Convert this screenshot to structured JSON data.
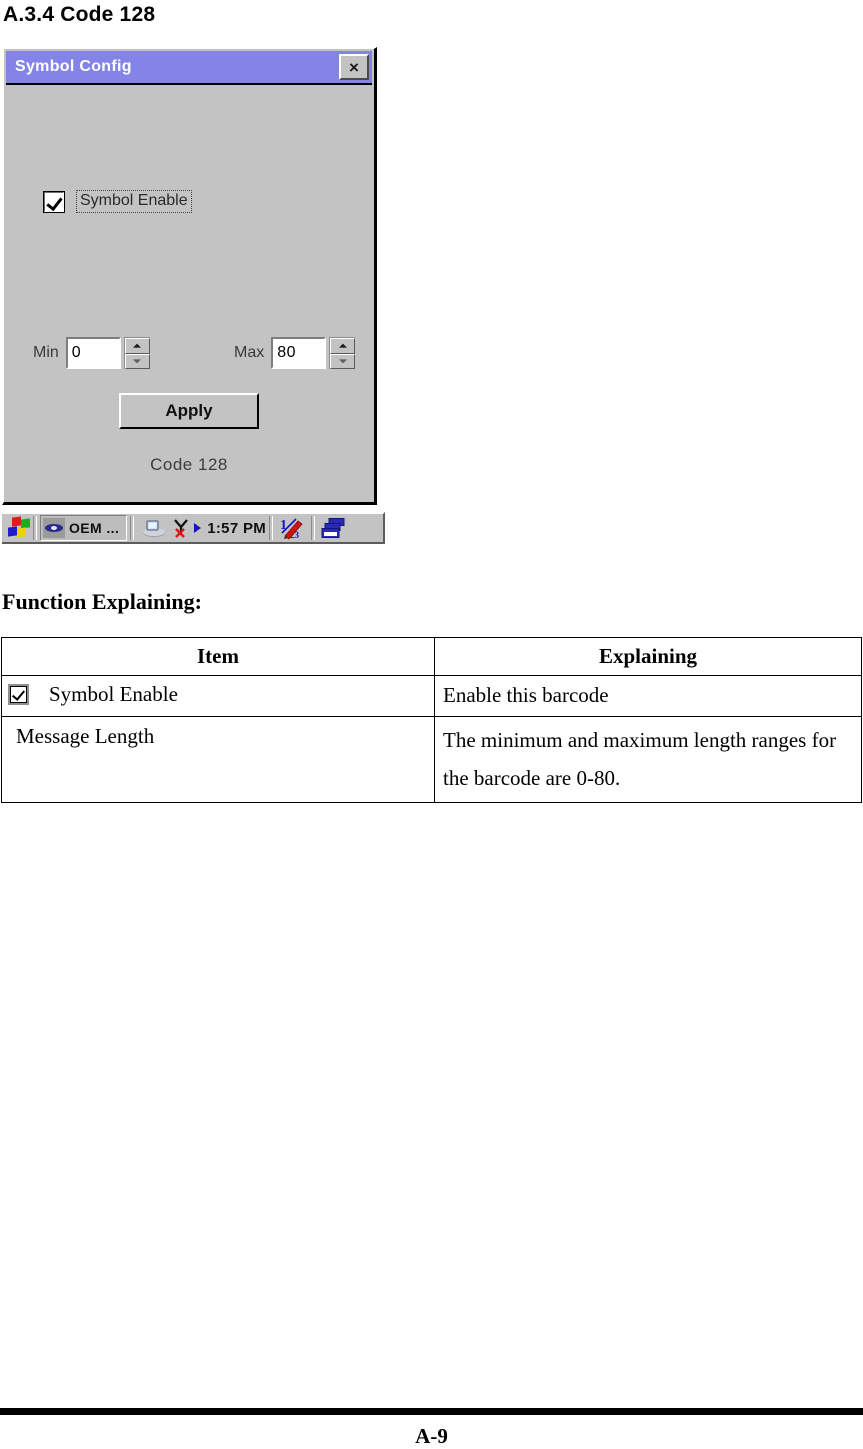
{
  "document": {
    "section_heading": "A.3.4 Code 128",
    "function_heading": "Function Explaining:",
    "page_number": "A-9"
  },
  "device_screenshot": {
    "dialog": {
      "title": "Symbol Config",
      "close_label": "×",
      "checkbox": {
        "label": "Symbol Enable",
        "checked": true
      },
      "min_field": {
        "caption": "Min",
        "value": "0"
      },
      "max_field": {
        "caption": "Max",
        "value": "80"
      },
      "apply_button": "Apply",
      "status_label": "Code 128"
    },
    "taskbar": {
      "start_icon": "windows-flag-icon",
      "task_button": {
        "icon": "oem-app-icon",
        "label": "OEM ..."
      },
      "tray_icons": [
        "desktop-icon",
        "antenna-disconnected-icon",
        "blue-arrow-icon",
        "sip-keyboard-icon",
        "window-switch-icon"
      ],
      "clock": "1:57 PM"
    }
  },
  "table": {
    "headers": [
      "Item",
      "Explaining"
    ],
    "rows": [
      {
        "item": "Symbol Enable",
        "item_has_checkbox": true,
        "explaining": "Enable this barcode"
      },
      {
        "item": "Message Length",
        "item_has_checkbox": false,
        "explaining": "The minimum and maximum length ranges for the barcode are 0-80."
      }
    ]
  },
  "colors": {
    "titlebar": "#8484e8",
    "dialog_face": "#c3c3c3",
    "text": "#000000"
  }
}
